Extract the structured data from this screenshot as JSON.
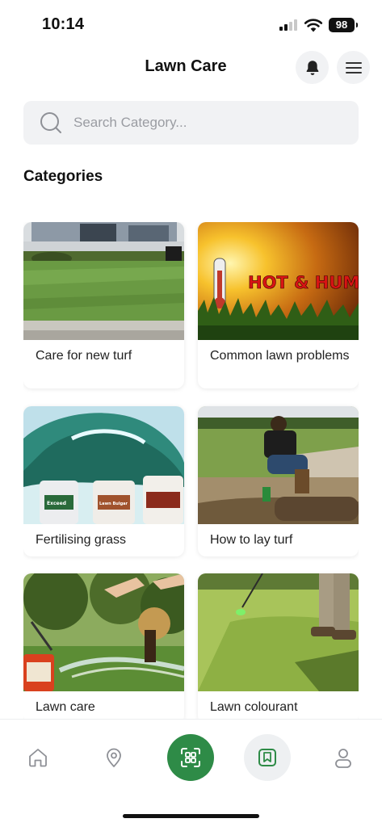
{
  "status_bar": {
    "time": "10:14",
    "battery": "98",
    "icons": [
      "signal-icon",
      "wifi-icon",
      "battery-icon"
    ]
  },
  "header": {
    "title": "Lawn Care",
    "bell_icon": "bell-icon",
    "menu_icon": "hamburger-menu-icon"
  },
  "search": {
    "placeholder": "Search Category...",
    "value": ""
  },
  "categories": {
    "heading": "Categories",
    "items": [
      {
        "label": "Care for new turf",
        "image": "new-turf-photo"
      },
      {
        "label": "Common lawn problems",
        "image": "hot-humid-photo",
        "image_text": "HOT & HUMID?"
      },
      {
        "label": "Fertilising grass",
        "image": "fertiliser-wave-photo",
        "bottle_labels": [
          "Exceed",
          "Lawn Bulgar"
        ]
      },
      {
        "label": "How to lay turf",
        "image": "laying-turf-photo"
      },
      {
        "label": "Lawn care",
        "image": "lawn-spraying-photo"
      },
      {
        "label": "Lawn colourant",
        "image": "colourant-spraying-photo"
      }
    ]
  },
  "tab_bar": {
    "tabs": [
      {
        "icon": "home-icon",
        "active": false
      },
      {
        "icon": "location-pin-icon",
        "active": false
      },
      {
        "icon": "scan-icon",
        "active": true
      },
      {
        "icon": "bookmark-icon",
        "active": false
      },
      {
        "icon": "profile-icon",
        "active": false
      }
    ]
  },
  "colors": {
    "accent": "#2e8b47",
    "search_bg": "#f1f2f4",
    "placeholder": "#9a9ca2"
  }
}
